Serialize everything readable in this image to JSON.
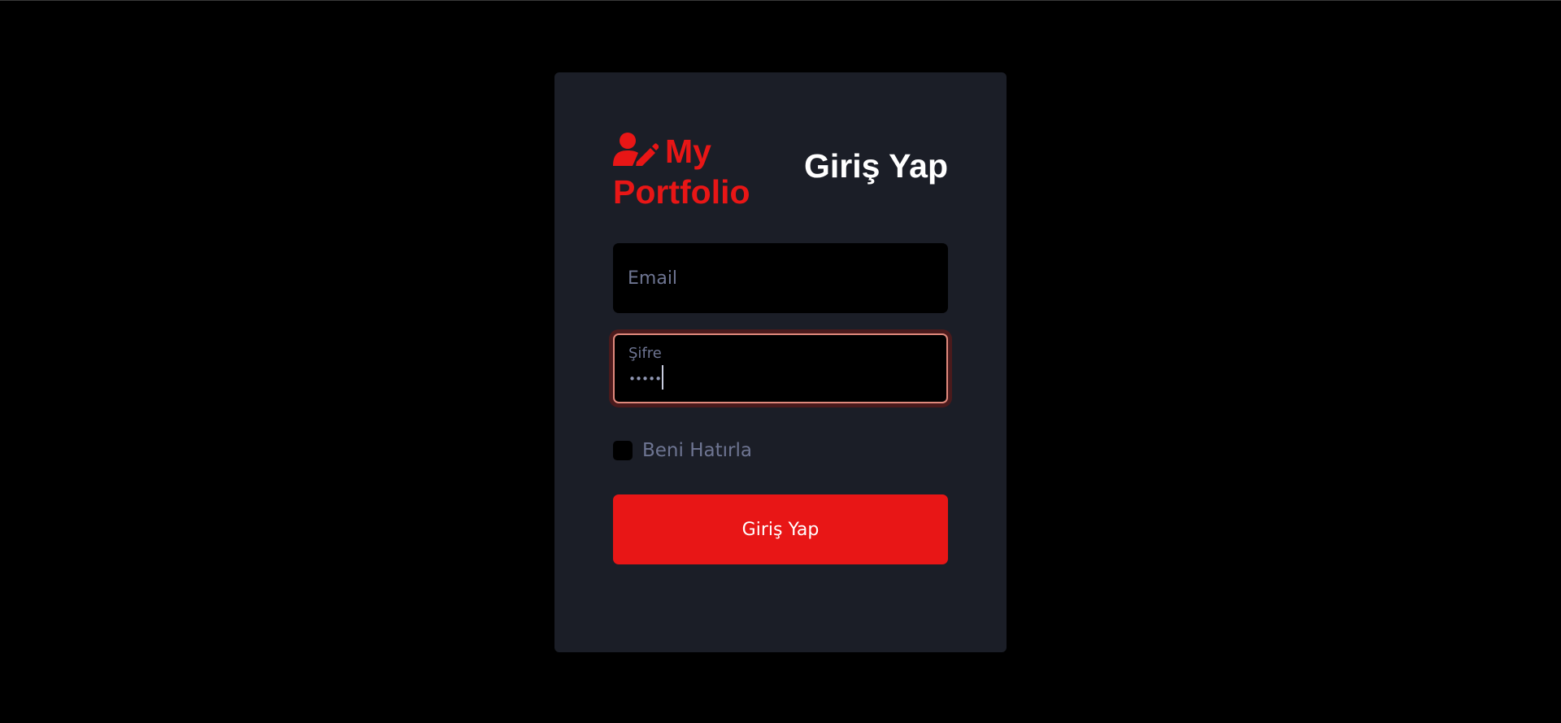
{
  "brand": {
    "name": "My Portfolio",
    "icon": "user-edit-icon",
    "color": "#e81616"
  },
  "login": {
    "title": "Giriş Yap",
    "email_placeholder": "Email",
    "password_label": "Şifre",
    "password_value": "•••••",
    "remember_label": "Beni Hatırla",
    "remember_checked": false,
    "submit_label": "Giriş Yap"
  },
  "colors": {
    "background": "#000000",
    "card": "#1b1e27",
    "accent": "#e81616",
    "muted_text": "#6e7592",
    "focus_border": "#e0897c"
  }
}
